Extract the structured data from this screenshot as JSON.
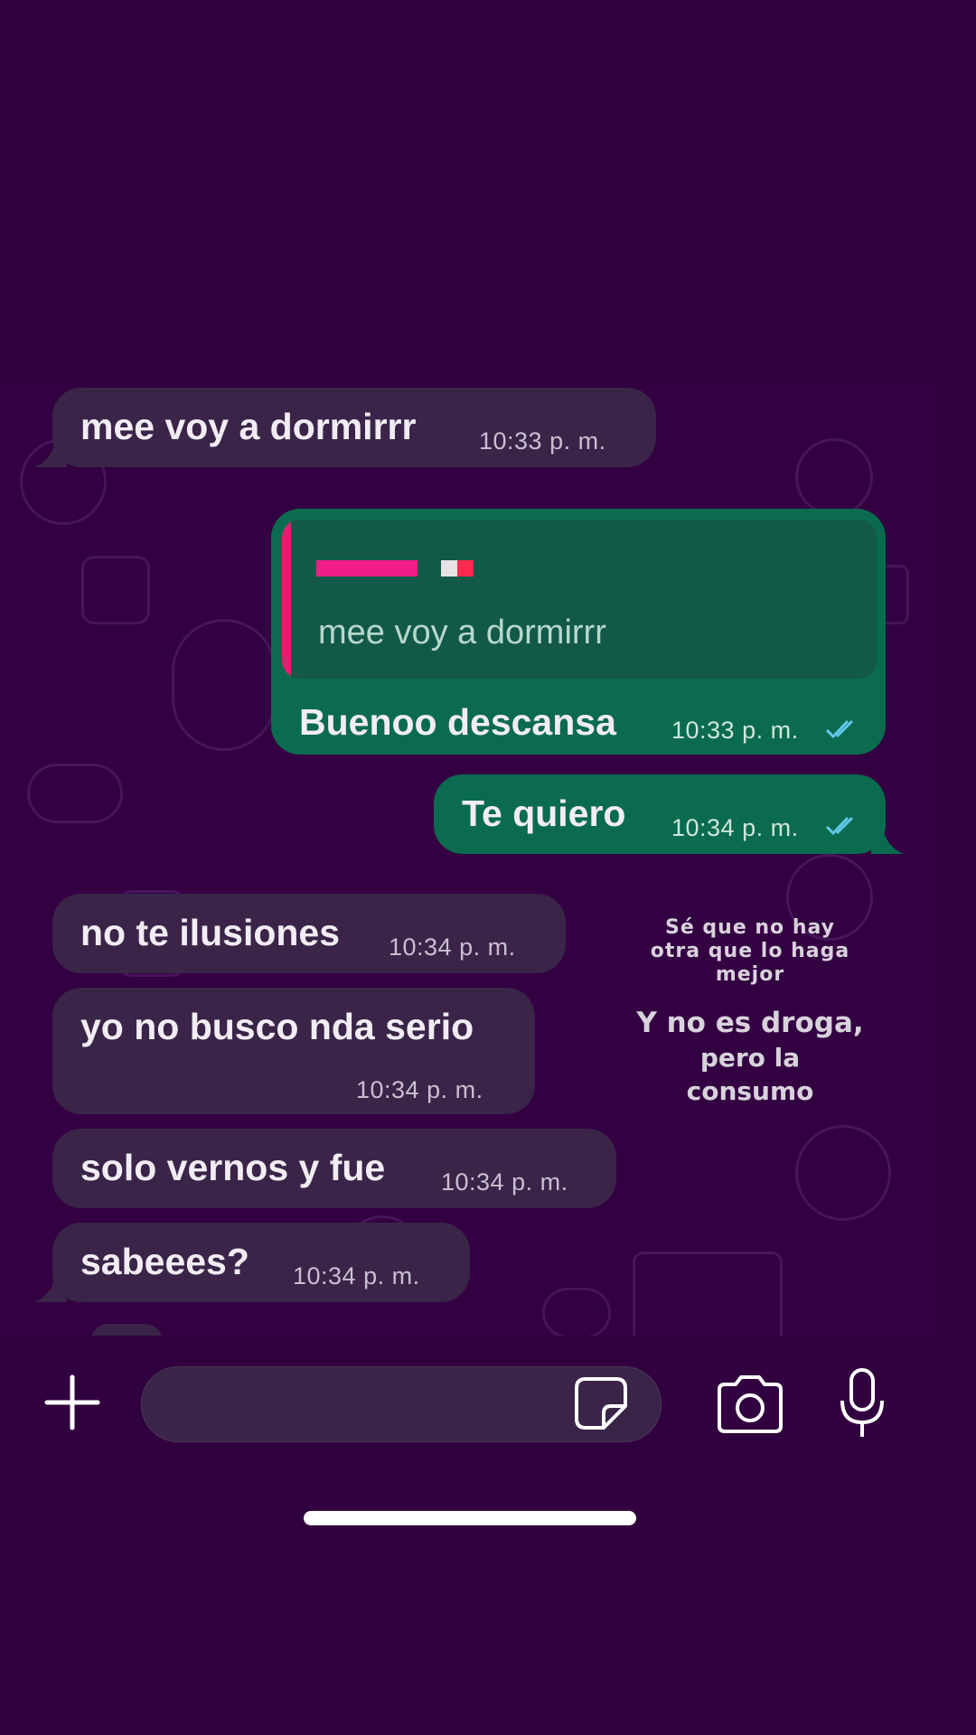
{
  "colors": {
    "background": "#31003f",
    "incoming_bubble": "#3a2549",
    "outgoing_bubble": "#0b6b4f",
    "read_ticks": "#5fc8e8"
  },
  "messages": [
    {
      "direction": "incoming",
      "text": "mee voy a dormirrr",
      "time": "10:33 p. m."
    },
    {
      "direction": "outgoing",
      "quote": {
        "text": "mee voy a dormirrr"
      },
      "text": "Buenoo descansa",
      "time": "10:33 p. m.",
      "status": "read"
    },
    {
      "direction": "outgoing",
      "text": "Te quiero",
      "time": "10:34 p. m.",
      "status": "read"
    },
    {
      "direction": "incoming",
      "text": "no te ilusiones",
      "time": "10:34 p. m."
    },
    {
      "direction": "incoming",
      "text": "yo no busco nda serio",
      "time": "10:34 p. m."
    },
    {
      "direction": "incoming",
      "text": "solo vernos y fue",
      "time": "10:34 p. m."
    },
    {
      "direction": "incoming",
      "text": "sabeees?",
      "time": "10:34 p. m."
    }
  ],
  "overlay": {
    "line1": "Sé que no hay",
    "line2": "otra que lo haga",
    "line3": "mejor",
    "line4": "Y no es droga,",
    "line5": "pero la",
    "line6": "consumo"
  },
  "composer": {
    "icons": [
      "plus-icon",
      "sticker-icon",
      "camera-icon",
      "microphone-icon"
    ]
  }
}
